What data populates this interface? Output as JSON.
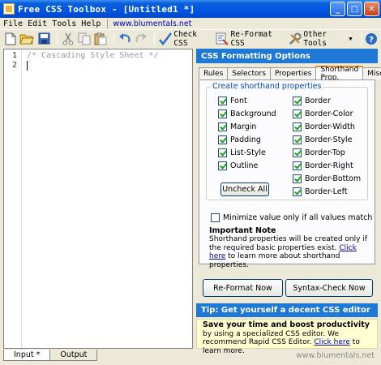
{
  "window": {
    "title": "Free CSS Toolbox - [Untitled1 *]",
    "controls": {
      "minimize": "_",
      "maximize": "□",
      "close": "✕"
    }
  },
  "menu": {
    "items": [
      {
        "label": "File"
      },
      {
        "label": "Edit"
      },
      {
        "label": "Tools"
      },
      {
        "label": "Help"
      }
    ],
    "link": "www.blumentals.net"
  },
  "toolbar": {
    "check_css": "Check CSS",
    "reformat_css": "Re-Format CSS",
    "other_tools": "Other Tools",
    "icons": [
      "new-icon",
      "open-icon",
      "save-icon",
      "cut-icon",
      "copy-icon",
      "paste-icon",
      "undo-icon",
      "redo-icon",
      "help-icon"
    ]
  },
  "editor": {
    "line_numbers": [
      "1",
      "2"
    ],
    "lines": [
      "/* Cascading Style Sheet */",
      ""
    ]
  },
  "bottom_tabs": [
    {
      "label": "Input *",
      "active": true
    },
    {
      "label": "Output",
      "active": false
    }
  ],
  "footer_site": "www.blumentals.net",
  "panel": {
    "header": "CSS Formatting Options",
    "tabs": [
      {
        "label": "Rules"
      },
      {
        "label": "Selectors"
      },
      {
        "label": "Properties"
      },
      {
        "label": "Shorthand Prop."
      },
      {
        "label": "Misc"
      }
    ],
    "active_tab": "Shorthand Prop.",
    "group_title": "Create shorthand properties",
    "left_checkboxes": [
      {
        "label": "Font",
        "checked": true
      },
      {
        "label": "Background",
        "checked": true
      },
      {
        "label": "Margin",
        "checked": true
      },
      {
        "label": "Padding",
        "checked": true
      },
      {
        "label": "List-Style",
        "checked": true
      },
      {
        "label": "Outline",
        "checked": true
      }
    ],
    "right_checkboxes": [
      {
        "label": "Border",
        "checked": true
      },
      {
        "label": "Border-Color",
        "checked": true
      },
      {
        "label": "Border-Width",
        "checked": true
      },
      {
        "label": "Border-Style",
        "checked": true
      },
      {
        "label": "Border-Top",
        "checked": true
      },
      {
        "label": "Border-Right",
        "checked": true
      },
      {
        "label": "Border-Bottom",
        "checked": true
      },
      {
        "label": "Border-Left",
        "checked": true
      }
    ],
    "uncheck_all": "Uncheck All",
    "minimize_option": {
      "label": "Minimize value only if all values match",
      "checked": false
    },
    "note_title": "Important Note",
    "note_text_1": "Shorthand properties will be created only if the required basic properties exist.",
    "note_link": "Click here",
    "note_text_2": "to learn more about shorthand properties.",
    "reformat_button": "Re-Format Now",
    "syntax_button": "Syntax-Check Now",
    "tip_header": "Tip: Get yourself a decent CSS editor",
    "tip_bold": "Save your time and boost productivity",
    "tip_text": "by using a specialized CSS editor. We recommend Rapid CSS Editor.",
    "tip_link": "Click here",
    "tip_text_2": "to learn more."
  },
  "colors": {
    "titlebar": "#0055e5",
    "panel_header": "#1e78d4",
    "tip_background": "#ffffd2",
    "link": "#0000c0",
    "check": "#21a121"
  }
}
